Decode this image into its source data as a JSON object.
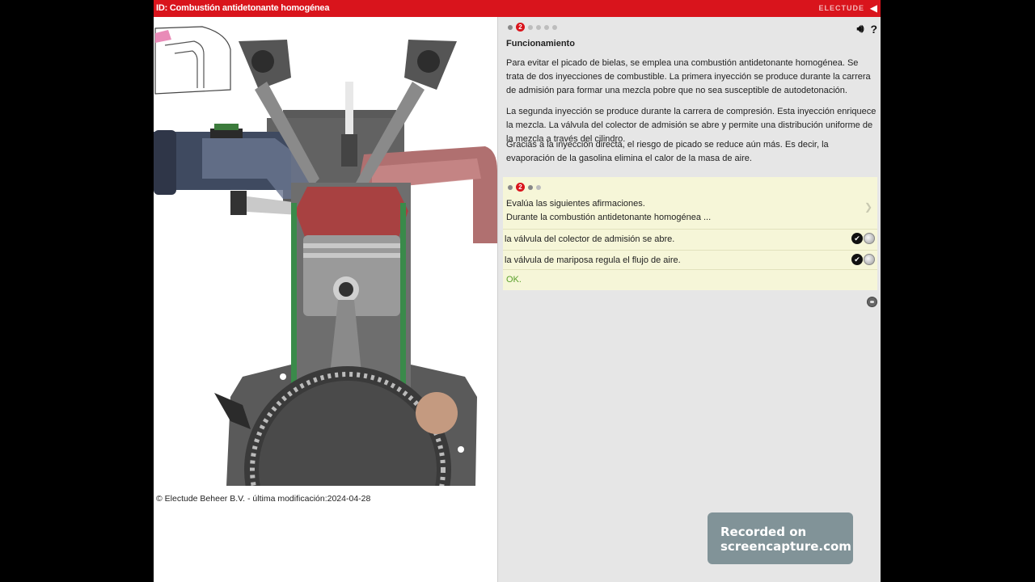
{
  "header": {
    "title": "ID: Combustión antidetonante homogénea",
    "brand": "ELECTUDE",
    "brand_accent": "E",
    "collapse_icon": "chevron-left-icon"
  },
  "colors": {
    "accent": "#d9141c",
    "ok": "#5aa02c",
    "quiz_bg": "#f6f6d8",
    "panel_bg": "#e6e6e6"
  },
  "footer": {
    "copyright": "© Electude Beheer B.V. - última modificación:2024-04-28"
  },
  "content": {
    "step_active": "2",
    "icons": [
      "speaker-icon",
      "help-icon"
    ],
    "section_title": "Funcionamiento",
    "paragraphs": [
      "Para evitar el picado de bielas, se emplea una combustión antidetonante homogénea. Se trata de dos inyecciones de combustible. La primera inyección se produce durante la carrera de admisión para formar una mezcla pobre que no sea susceptible de autodetonación.",
      "La segunda inyección se produce durante la carrera de compresión. Esta inyección enriquece la mezcla. La válvula del colector de admisión se abre y permite una distribución uniforme de la mezcla a través del cilindro.",
      "Gracias a la inyección directa, el riesgo de picado se reduce aún más. Es decir, la evaporación de la gasolina elimina el calor de la masa de aire."
    ]
  },
  "quiz": {
    "step_active": "2",
    "prompt_line1": "Evalúa las siguientes afirmaciones.",
    "prompt_line2": "Durante la combustión antidetonante homogénea ...",
    "statements": [
      {
        "text": "la válvula del colector de admisión se abre.",
        "checked": true
      },
      {
        "text": "la válvula de mariposa regula el flujo de aire.",
        "checked": true
      }
    ],
    "feedback": "OK."
  },
  "watermark": {
    "line1": "Recorded on",
    "line2": "screencapture.com"
  }
}
